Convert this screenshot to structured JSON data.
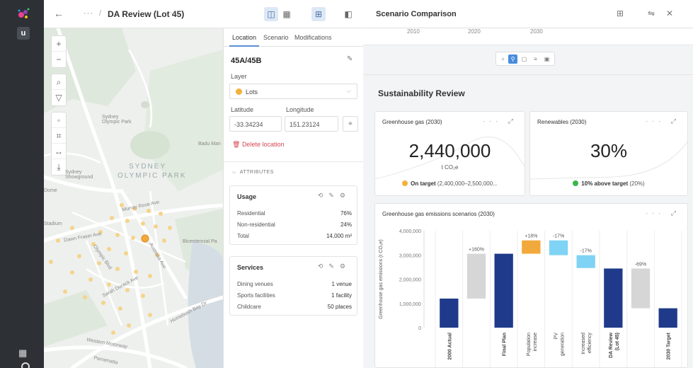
{
  "topbar": {
    "breadcrumb_dots": "···",
    "breadcrumb_sep": "/",
    "title": "DA Review (Lot 45)"
  },
  "rail": {
    "app_letter": "u"
  },
  "map": {
    "labels": {
      "sydney_olympic_park_small": "Sydney\nOlympic Park",
      "sydney_big": "SYDNEY",
      "olympic_park_big": "OLYMPIC PARK",
      "showground": "Sydney\nShowground",
      "dome": "Dome",
      "stadium": "Stadium",
      "bicentennial": "Bicentennial Pa",
      "badu": "Badu Man",
      "murray_rose": "Murray Rose Ave",
      "dawn_fraser": "Dawn Fraser Ave",
      "australia_ave": "Australia Ave",
      "olympic_blvd": "Olympic Blvd",
      "sarah_durack": "Sarah Durack Ave",
      "homebush_bay": "Homebush Bay Dr",
      "western_mwy": "Western Motorway",
      "parramatta": "Parramatta"
    }
  },
  "detail": {
    "tabs": [
      "Location",
      "Scenario",
      "Modifications"
    ],
    "title": "45A/45B",
    "layer_label": "Layer",
    "layer_value": "Lots",
    "latitude_label": "Latitude",
    "longitude_label": "Longitude",
    "latitude_value": "-33.34234",
    "longitude_value": "151.23124",
    "delete_label": "Delete location",
    "attributes_label": "ATTRIBUTES",
    "usage": {
      "title": "Usage",
      "rows": [
        {
          "label": "Residential",
          "value": "76%"
        },
        {
          "label": "Non-residential",
          "value": "24%"
        },
        {
          "label": "Total",
          "value": "14,000 m²"
        }
      ]
    },
    "services": {
      "title": "Services",
      "rows": [
        {
          "label": "Dining venues",
          "value": "1 venue"
        },
        {
          "label": "Sports facilities",
          "value": "1 facility"
        },
        {
          "label": "Childcare",
          "value": "50 places"
        }
      ]
    }
  },
  "right": {
    "title": "Scenario Comparison",
    "years": [
      "2010",
      "2020",
      "2030"
    ],
    "section_title": "Sustainability Review",
    "kpis": [
      {
        "title": "Greenhouse gas (2030)",
        "value": "2,440,000",
        "unit": "t CO₂e",
        "status_bold": "On target",
        "status_rest": "(2,400,000–2,500,000...",
        "status_color": "#f2b13c"
      },
      {
        "title": "Renewables (2030)",
        "value": "30%",
        "unit": "",
        "status_bold": "10% above target",
        "status_rest": "(20%)",
        "status_color": "#3bb54a"
      }
    ],
    "chart_title": "Greenhouse gas emissions scenarios (2030)"
  },
  "chart_data": {
    "type": "bar",
    "title": "Greenhouse gas emissions scenarios (2030)",
    "ylabel": "Greenhouse gas emissions (t CO₂e)",
    "ylim": [
      0,
      4000000
    ],
    "yticks": [
      "0",
      "1,000,000",
      "2,000,000",
      "3,000,000",
      "4,000,000"
    ],
    "categories": [
      "2000 Actual",
      "",
      "Final Plan",
      "Population increase",
      "PV generation",
      "Increased efficiency",
      "DA Review (Lot 45)",
      "",
      "2030 Target"
    ],
    "bars": [
      {
        "category": "2000 Actual",
        "kind": "total",
        "low": 0,
        "high": 1200000,
        "color": "#1f3a8a",
        "label": ""
      },
      {
        "category": "",
        "kind": "delta",
        "low": 1200000,
        "high": 3050000,
        "color": "#d6d6d6",
        "label": "+160%"
      },
      {
        "category": "Final Plan",
        "kind": "total",
        "low": 0,
        "high": 3050000,
        "color": "#1f3a8a",
        "label": ""
      },
      {
        "category": "Population increase",
        "kind": "delta",
        "low": 3050000,
        "high": 3600000,
        "color": "#f2a93b",
        "label": "+18%"
      },
      {
        "category": "PV generation",
        "kind": "delta",
        "low": 2990000,
        "high": 3600000,
        "color": "#7fd3f5",
        "label": "-17%"
      },
      {
        "category": "Increased efficiency",
        "kind": "delta",
        "low": 2460000,
        "high": 2990000,
        "color": "#7fd3f5",
        "label": "-17%"
      },
      {
        "category": "DA Review (Lot 45)",
        "kind": "total",
        "low": 0,
        "high": 2440000,
        "color": "#1f3a8a",
        "label": ""
      },
      {
        "category": "",
        "kind": "delta",
        "low": 800000,
        "high": 2440000,
        "color": "#d6d6d6",
        "label": "-69%"
      },
      {
        "category": "2030 Target",
        "kind": "total",
        "low": 0,
        "high": 800000,
        "color": "#1f3a8a",
        "label": ""
      }
    ]
  }
}
